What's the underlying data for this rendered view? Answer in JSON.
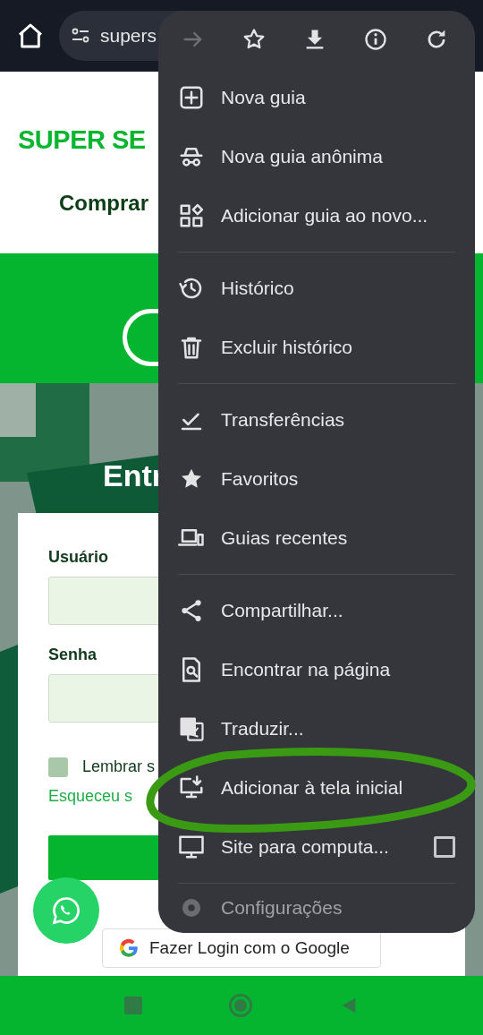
{
  "toolbar": {
    "url": "supers"
  },
  "page": {
    "logo": "SUPER SE",
    "tagline": "Comprar",
    "login_title": "Entr",
    "fields": [
      {
        "label": "Usuário"
      },
      {
        "label": "Senha"
      }
    ],
    "remember": {
      "label": "Lembrar s",
      "checked": false
    },
    "forgot_link": "Esqueceu s",
    "google_button": "Fazer Login com o Google"
  },
  "menu": {
    "actions": [
      {
        "disabled": true
      },
      {
        "disabled": false
      },
      {
        "disabled": false
      },
      {
        "disabled": false
      },
      {
        "disabled": false
      }
    ],
    "entries": [
      {
        "kind": "item",
        "label": "Nova guia"
      },
      {
        "kind": "item",
        "label": "Nova guia anônima"
      },
      {
        "kind": "item",
        "label": "Adicionar guia ao novo..."
      },
      {
        "kind": "divider"
      },
      {
        "kind": "item",
        "label": "Histórico"
      },
      {
        "kind": "item",
        "label": "Excluir histórico"
      },
      {
        "kind": "divider"
      },
      {
        "kind": "item",
        "label": "Transferências"
      },
      {
        "kind": "item",
        "label": "Favoritos"
      },
      {
        "kind": "item",
        "label": "Guias recentes"
      },
      {
        "kind": "divider"
      },
      {
        "kind": "item",
        "label": "Compartilhar..."
      },
      {
        "kind": "item",
        "label": "Encontrar na página"
      },
      {
        "kind": "item",
        "label": "Traduzir..."
      },
      {
        "kind": "item",
        "label": "Adicionar à tela inicial"
      },
      {
        "kind": "toggle",
        "label": "Site para computa...",
        "checked": false
      },
      {
        "kind": "divider"
      },
      {
        "kind": "item",
        "label": "Configurações"
      }
    ]
  }
}
